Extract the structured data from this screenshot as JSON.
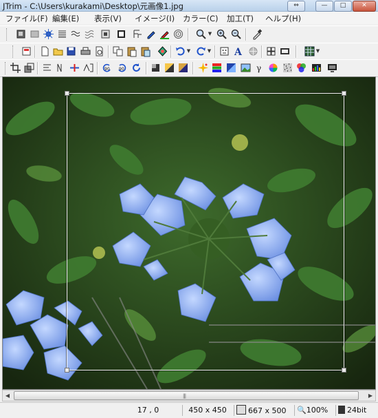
{
  "window": {
    "title": "JTrim - C:\\Users\\kurakami\\Desktop\\元画像1.jpg",
    "controls": [
      "restore-down",
      "minimize",
      "maximize",
      "close"
    ]
  },
  "menu": {
    "items": [
      "ファイル(F)",
      "編集(E)",
      "表示(V)",
      "イメージ(I)",
      "カラー(C)",
      "加工(T)",
      "ヘルプ(H)"
    ]
  },
  "toolbars": {
    "row1": [
      "emboss",
      "gray-frame",
      "star-burst",
      "dither",
      "wave",
      "wave-alt",
      "3d-frame",
      "stamp",
      "filter",
      "pen",
      "color-pen",
      "spiral",
      "zoom",
      "zoom-in",
      "zoom-out",
      "eyedropper"
    ],
    "row2": [
      "properties",
      "new",
      "open",
      "save",
      "print",
      "print-preview",
      "copy",
      "paste",
      "paste-new",
      "brush-mask",
      "undo",
      "redo",
      "face",
      "text",
      "circle",
      "image",
      "grid-4",
      "grid-film",
      "grid-3"
    ],
    "row3": [
      "crop",
      "resize",
      "flip-vertical",
      "flip-horizontal",
      "mirror",
      "rotate-90-left",
      "rotate-90-right",
      "rotate-reset",
      "gradient-square",
      "brightness",
      "contrast",
      "gradient-fill",
      "picture",
      "gamma",
      "color-wheel",
      "noise",
      "rgb",
      "histogram",
      "monitor"
    ]
  },
  "image": {
    "description_alt": "blue plumbago flowers",
    "selection_visible": true
  },
  "scrollbar": {
    "thumb_grip": "|||"
  },
  "status": {
    "cursor": "17 , 0",
    "selection_size": "450 x 450",
    "image_size": "667 x 500",
    "zoom": "100%",
    "color_depth": "24bit"
  },
  "colors": {
    "titlebar": "#c6d9ee",
    "selection": "#f2f2f2",
    "flower": "#7fa5ef",
    "leaves": "#2f5a22"
  }
}
